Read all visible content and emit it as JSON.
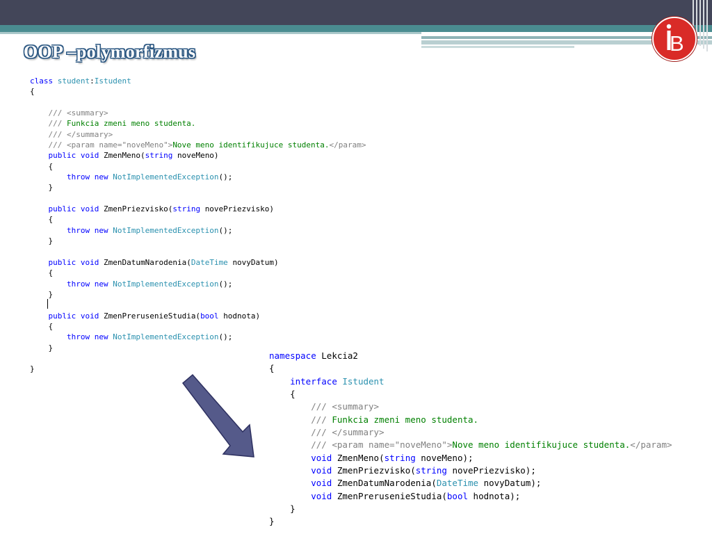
{
  "slide": {
    "title": "OOP –polymorfizmus",
    "logo": {
      "icon": "ib-logo-icon",
      "letter": "B",
      "color": "#d92b27"
    }
  },
  "code_class": [
    [
      [
        "kw",
        "class "
      ],
      [
        "ty",
        "student"
      ],
      [
        "pl",
        ":"
      ],
      [
        "ty",
        "Istudent"
      ]
    ],
    [
      [
        "pl",
        "{"
      ]
    ],
    [],
    [
      [
        "pl",
        "    "
      ],
      [
        "cg",
        "/// <summary>"
      ]
    ],
    [
      [
        "pl",
        "    "
      ],
      [
        "cg",
        "/// "
      ],
      [
        "cm",
        "Funkcia zmeni meno studenta."
      ]
    ],
    [
      [
        "pl",
        "    "
      ],
      [
        "cg",
        "/// </summary>"
      ]
    ],
    [
      [
        "pl",
        "    "
      ],
      [
        "cg",
        "/// <param name=\"noveMeno\">"
      ],
      [
        "cm",
        "Nove meno identifikujuce studenta."
      ],
      [
        "cg",
        "</param>"
      ]
    ],
    [
      [
        "pl",
        "    "
      ],
      [
        "kw",
        "public void "
      ],
      [
        "pl",
        "ZmenMeno("
      ],
      [
        "kw",
        "string "
      ],
      [
        "pl",
        "noveMeno)"
      ]
    ],
    [
      [
        "pl",
        "    {"
      ]
    ],
    [
      [
        "pl",
        "        "
      ],
      [
        "kw",
        "throw new "
      ],
      [
        "ty",
        "NotImplementedException"
      ],
      [
        "pl",
        "();"
      ]
    ],
    [
      [
        "pl",
        "    }"
      ]
    ],
    [],
    [
      [
        "pl",
        "    "
      ],
      [
        "kw",
        "public void "
      ],
      [
        "pl",
        "ZmenPriezvisko("
      ],
      [
        "kw",
        "string "
      ],
      [
        "pl",
        "novePriezvisko)"
      ]
    ],
    [
      [
        "pl",
        "    {"
      ]
    ],
    [
      [
        "pl",
        "        "
      ],
      [
        "kw",
        "throw new "
      ],
      [
        "ty",
        "NotImplementedException"
      ],
      [
        "pl",
        "();"
      ]
    ],
    [
      [
        "pl",
        "    }"
      ]
    ],
    [],
    [
      [
        "pl",
        "    "
      ],
      [
        "kw",
        "public void "
      ],
      [
        "pl",
        "ZmenDatumNarodenia("
      ],
      [
        "ty",
        "DateTime "
      ],
      [
        "pl",
        "novyDatum)"
      ]
    ],
    [
      [
        "pl",
        "    {"
      ]
    ],
    [
      [
        "pl",
        "        "
      ],
      [
        "kw",
        "throw new "
      ],
      [
        "ty",
        "NotImplementedException"
      ],
      [
        "pl",
        "();"
      ]
    ],
    [
      [
        "pl",
        "    }"
      ]
    ],
    [],
    [
      [
        "pl",
        "    "
      ],
      [
        "kw",
        "public void "
      ],
      [
        "pl",
        "ZmenPrerusenieStudia("
      ],
      [
        "kw",
        "bool "
      ],
      [
        "pl",
        "hodnota)"
      ]
    ],
    [
      [
        "pl",
        "    {"
      ]
    ],
    [
      [
        "pl",
        "        "
      ],
      [
        "kw",
        "throw new "
      ],
      [
        "ty",
        "NotImplementedException"
      ],
      [
        "pl",
        "();"
      ]
    ],
    [
      [
        "pl",
        "    }"
      ]
    ],
    [],
    [
      [
        "pl",
        "}"
      ]
    ]
  ],
  "code_interface": [
    [
      [
        "kw",
        "namespace "
      ],
      [
        "pl",
        "Lekcia2"
      ]
    ],
    [
      [
        "pl",
        "{"
      ]
    ],
    [
      [
        "pl",
        "    "
      ],
      [
        "kw",
        "interface "
      ],
      [
        "ty",
        "Istudent"
      ]
    ],
    [
      [
        "pl",
        "    {"
      ]
    ],
    [
      [
        "pl",
        "        "
      ],
      [
        "cg",
        "/// <summary>"
      ]
    ],
    [
      [
        "pl",
        "        "
      ],
      [
        "cg",
        "/// "
      ],
      [
        "cm",
        "Funkcia zmeni meno studenta."
      ]
    ],
    [
      [
        "pl",
        "        "
      ],
      [
        "cg",
        "/// </summary>"
      ]
    ],
    [
      [
        "pl",
        "        "
      ],
      [
        "cg",
        "/// <param name=\"noveMeno\">"
      ],
      [
        "cm",
        "Nove meno identifikujuce studenta."
      ],
      [
        "cg",
        "</param>"
      ]
    ],
    [
      [
        "pl",
        "        "
      ],
      [
        "kw",
        "void "
      ],
      [
        "pl",
        "ZmenMeno("
      ],
      [
        "kw",
        "string "
      ],
      [
        "pl",
        "noveMeno);"
      ]
    ],
    [
      [
        "pl",
        "        "
      ],
      [
        "kw",
        "void "
      ],
      [
        "pl",
        "ZmenPriezvisko("
      ],
      [
        "kw",
        "string "
      ],
      [
        "pl",
        "novePriezvisko);"
      ]
    ],
    [
      [
        "pl",
        "        "
      ],
      [
        "kw",
        "void "
      ],
      [
        "pl",
        "ZmenDatumNarodenia("
      ],
      [
        "ty",
        "DateTime "
      ],
      [
        "pl",
        "novyDatum);"
      ]
    ],
    [
      [
        "pl",
        "        "
      ],
      [
        "kw",
        "void "
      ],
      [
        "pl",
        "ZmenPrerusenieStudia("
      ],
      [
        "kw",
        "bool "
      ],
      [
        "pl",
        "hodnota);"
      ]
    ],
    [
      [
        "pl",
        "    }"
      ]
    ],
    [
      [
        "pl",
        "}"
      ]
    ]
  ],
  "colors": {
    "keyword": "#0000ff",
    "type": "#2b91af",
    "comment": "#008000",
    "doc_tag": "#808080",
    "arrow": "#555a8a",
    "header_dark": "#434659",
    "header_teal": "#4a8c90"
  },
  "decorations": {
    "arrow_icon": "arrow-down-right-icon"
  }
}
